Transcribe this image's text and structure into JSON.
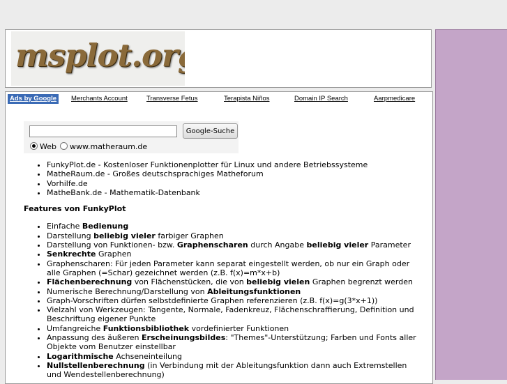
{
  "logo": {
    "text": "msplot.org"
  },
  "ads": {
    "label": "Ads by Google",
    "links": [
      "Merchants Account",
      "Transverse Fetus",
      "Terapista Niños",
      "Domain IP Search",
      "Aarpmedicare"
    ]
  },
  "search": {
    "input_value": "",
    "button_label": "Google-Suche",
    "option_web": "Web",
    "option_site": "www.matheraum.de",
    "selected": "Web"
  },
  "links": [
    "FunkyPlot.de - Kostenloser Funktionenplotter für Linux und andere Betriebssysteme",
    "MatheRaum.de - Großes deutschsprachiges Matheforum",
    "Vorhilfe.de",
    "MatheBank.de - Mathematik-Datenbank"
  ],
  "features": {
    "heading": "Features von FunkyPlot",
    "items": [
      [
        {
          "t": "Einfache "
        },
        {
          "t": "Bedienung",
          "b": true
        }
      ],
      [
        {
          "t": "Darstellung "
        },
        {
          "t": "beliebig vieler",
          "b": true
        },
        {
          "t": " farbiger Graphen"
        }
      ],
      [
        {
          "t": "Darstellung von Funktionen- bzw. "
        },
        {
          "t": "Graphenscharen",
          "b": true
        },
        {
          "t": " durch Angabe "
        },
        {
          "t": "beliebig vieler",
          "b": true
        },
        {
          "t": " Parameter"
        }
      ],
      [
        {
          "t": "Senkrechte",
          "b": true
        },
        {
          "t": " Graphen"
        }
      ],
      [
        {
          "t": "Graphenscharen: Für jeden Parameter kann separat eingestellt werden, ob nur ein Graph oder alle Graphen (=Schar) gezeichnet werden (z.B. f(x)=m*x+b)"
        }
      ],
      [
        {
          "t": "Flächenberechnung",
          "b": true
        },
        {
          "t": " von Flächenstücken, die von "
        },
        {
          "t": "beliebig vielen",
          "b": true
        },
        {
          "t": " Graphen begrenzt werden"
        }
      ],
      [
        {
          "t": "Numerische Berechnung/Darstellung von "
        },
        {
          "t": "Ableitungsfunktionen",
          "b": true
        }
      ],
      [
        {
          "t": "Graph-Vorschriften dürfen selbstdefinierte Graphen referenzieren (z.B. f(x)=g(3*x+1))"
        }
      ],
      [
        {
          "t": "Vielzahl von Werkzeugen: Tangente, Normale, Fadenkreuz, Flächenschraffierung, Definition und Beschriftung eigener Punkte"
        }
      ],
      [
        {
          "t": "Umfangreiche "
        },
        {
          "t": "Funktionsbibliothek",
          "b": true
        },
        {
          "t": " vordefinierter Funktionen"
        }
      ],
      [
        {
          "t": "Anpassung des äußeren "
        },
        {
          "t": "Erscheinungsbildes",
          "b": true
        },
        {
          "t": ": \"Themes\"-Unterstützung; Farben und Fonts aller Objekte vom Benutzer einstellbar"
        }
      ],
      [
        {
          "t": "Logarithmische",
          "b": true
        },
        {
          "t": " Achseneinteilung"
        }
      ],
      [
        {
          "t": "Nullstellenberechnung",
          "b": true
        },
        {
          "t": " (in Verbindung mit der Ableitungsfunktion dann auch Extremstellen und Wendestellenberechnung)"
        }
      ]
    ]
  },
  "colors": {
    "side_panel": "#c4a5c8",
    "ads_label_bg": "#3a6ab5"
  }
}
